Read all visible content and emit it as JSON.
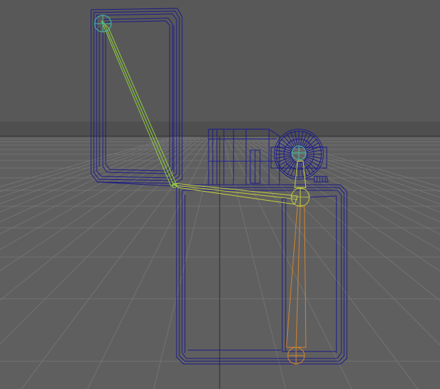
{
  "viewport": {
    "view": "perspective",
    "display_mode": "wireframe",
    "grid": true
  },
  "colors": {
    "background_upper": "#585858",
    "background_lower": "#5f5f5f",
    "horizon_band": "#4f4f4f",
    "grid_line": "#787878",
    "grid_axis": "#3a3a3a",
    "wireframe": "#1a1a8c",
    "wireframe_dark": "#101068",
    "bone_green": "#8fd13a",
    "bone_yellow": "#c8d43a",
    "bone_orange": "#d7862b",
    "joint_cyan": "#43c0a8"
  },
  "model": {
    "object": "lighter",
    "parts": [
      "lid",
      "body",
      "chimney",
      "flint-wheel",
      "cam"
    ]
  },
  "rig": {
    "joints": [
      "lid-joint",
      "hinge-joint",
      "cam-joint",
      "wheel-joint",
      "base-joint"
    ],
    "bones": [
      "lid-bone",
      "hinge-bone",
      "cam-bone-upper",
      "cam-bone-lower"
    ]
  }
}
